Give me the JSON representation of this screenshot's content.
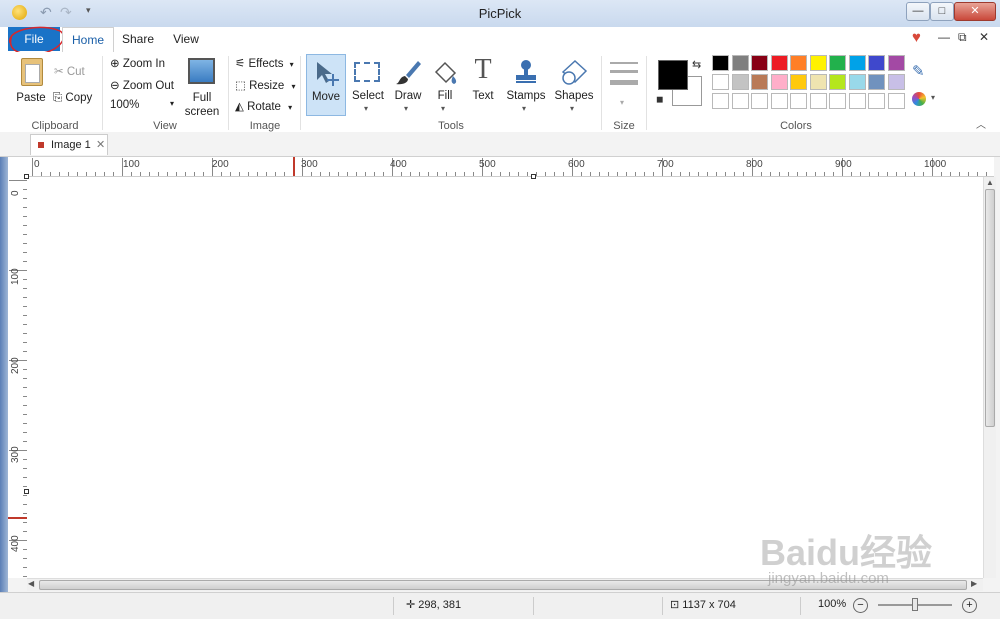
{
  "window": {
    "title": "PicPick"
  },
  "tabs": {
    "file": "File",
    "home": "Home",
    "share": "Share",
    "view": "View"
  },
  "clipboard": {
    "paste": "Paste",
    "cut": "Cut",
    "copy": "Copy",
    "group": "Clipboard"
  },
  "view_group": {
    "zoom_in": "Zoom In",
    "zoom_out": "Zoom Out",
    "zoom_level": "100%",
    "full_screen_1": "Full",
    "full_screen_2": "screen",
    "group": "View"
  },
  "image_group": {
    "effects": "Effects",
    "resize": "Resize",
    "rotate": "Rotate",
    "group": "Image"
  },
  "tools": {
    "move": "Move",
    "select": "Select",
    "draw": "Draw",
    "fill": "Fill",
    "text": "Text",
    "stamps": "Stamps",
    "shapes": "Shapes",
    "group": "Tools"
  },
  "size_group": {
    "group": "Size"
  },
  "colors": {
    "group": "Colors",
    "primary": "#000000",
    "secondary": "#ffffff",
    "row1": [
      "#000000",
      "#7f7f7f",
      "#880015",
      "#ed1c24",
      "#ff7f27",
      "#fff200",
      "#22b14c",
      "#00a2e8",
      "#3f48cc",
      "#a349a4"
    ],
    "row2": [
      "#ffffff",
      "#c3c3c3",
      "#b97a57",
      "#ffaec9",
      "#ffc90e",
      "#efe4b0",
      "#b5e61d",
      "#99d9ea",
      "#7092be",
      "#c8bfe7"
    ],
    "row3": [
      "#ffffff",
      "#ffffff",
      "#ffffff",
      "#ffffff",
      "#ffffff",
      "#ffffff",
      "#ffffff",
      "#ffffff",
      "#ffffff",
      "#ffffff"
    ]
  },
  "document": {
    "tab_name": "Image 1"
  },
  "rulers": {
    "h_labels": [
      "0",
      "100",
      "200",
      "300",
      "400",
      "500",
      "600",
      "700",
      "800",
      "900",
      "1000"
    ],
    "v_labels": [
      "0",
      "100",
      "200",
      "300",
      "400"
    ]
  },
  "status": {
    "cursor": "298, 381",
    "image_size": "1137 x 704",
    "zoom": "100%"
  },
  "watermark": {
    "logo": "Baidu经验",
    "url": "jingyan.baidu.com"
  }
}
